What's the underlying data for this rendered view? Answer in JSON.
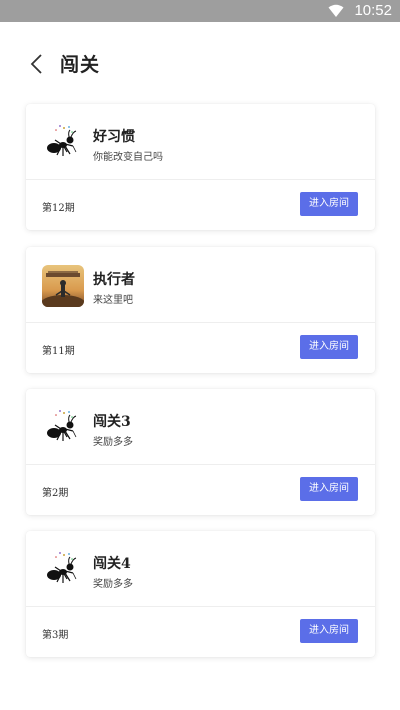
{
  "status_bar": {
    "time": "10:52"
  },
  "header": {
    "title": "闯关"
  },
  "colors": {
    "accent": "#5b6ee8",
    "status_bar": "#9e9e9e"
  },
  "rooms": [
    {
      "name": "好习惯",
      "desc": "你能改变自己吗",
      "period": "第12期",
      "button": "进入房间",
      "thumb_icon": "ant-icon"
    },
    {
      "name": "执行者",
      "desc": "来这里吧",
      "period": "第11期",
      "button": "进入房间",
      "thumb_icon": "scene-image"
    },
    {
      "name": "闯关3",
      "desc": "奖励多多",
      "period": "第2期",
      "button": "进入房间",
      "thumb_icon": "ant-icon"
    },
    {
      "name": "闯关4",
      "desc": "奖励多多",
      "period": "第3期",
      "button": "进入房间",
      "thumb_icon": "ant-icon"
    }
  ]
}
